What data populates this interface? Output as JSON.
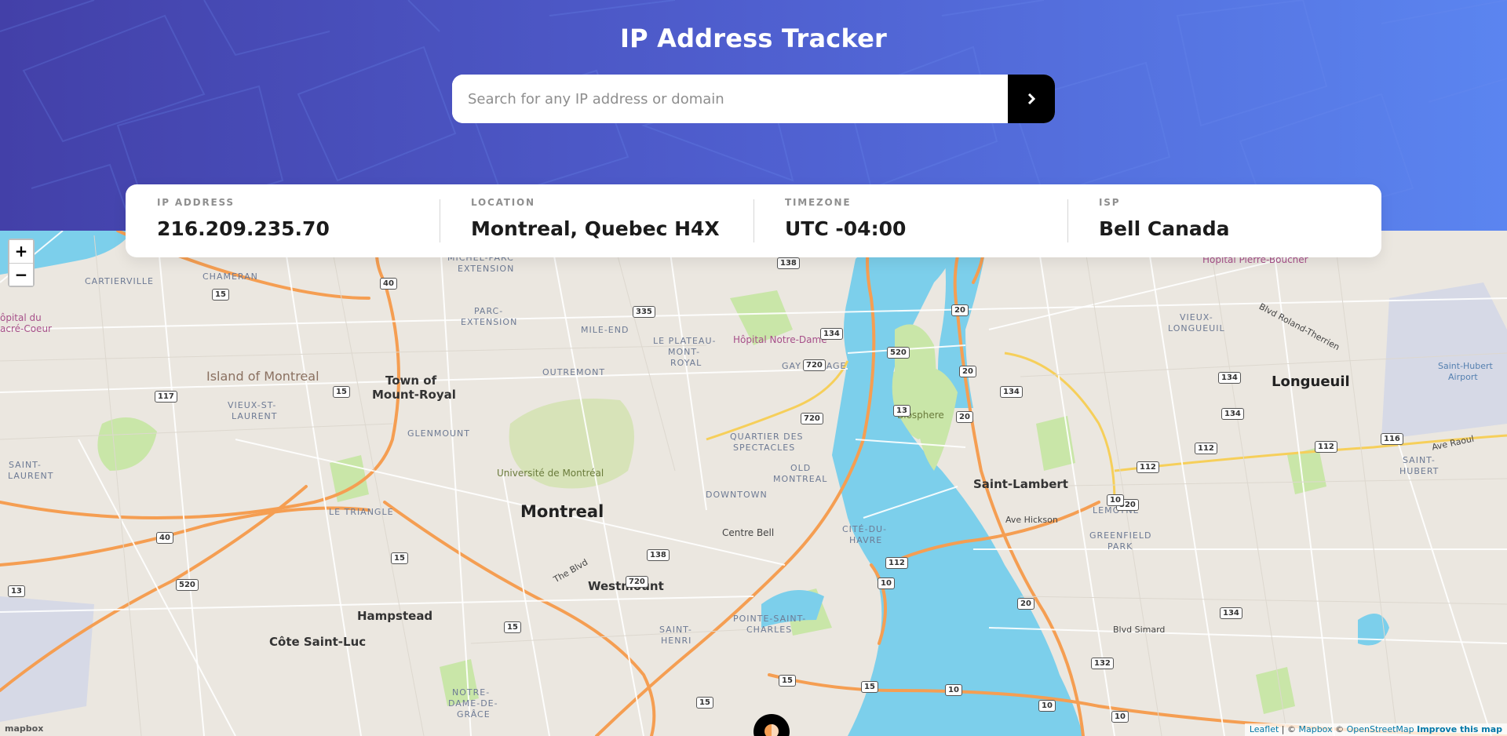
{
  "header": {
    "title": "IP Address Tracker",
    "search_placeholder": "Search for any IP address or domain",
    "search_value": "",
    "submit_icon": "chevron-right-icon",
    "gradient_colors": [
      "#4340a8",
      "#5b85f0"
    ]
  },
  "info": {
    "ip": {
      "label": "IP ADDRESS",
      "value": "216.209.235.70"
    },
    "location": {
      "label": "LOCATION",
      "value": "Montreal, Quebec H4X"
    },
    "timezone": {
      "label": "TIMEZONE",
      "value": "UTC -04:00"
    },
    "isp": {
      "label": "ISP",
      "value": "Bell Canada"
    }
  },
  "map": {
    "zoom_in": "+",
    "zoom_out": "−",
    "marker_icon": "location-pin-icon",
    "labels": {
      "montreal": "Montreal",
      "longueuil": "Longueuil",
      "saint_lambert": "Saint-Lambert",
      "westmount": "Westmount",
      "hampstead": "Hampstead",
      "cote_saint_luc": "Côte Saint-Luc",
      "town_of_mount_royal_1": "Town of",
      "town_of_mount_royal_2": "Mount-Royal",
      "island_of_montreal": "Island of Montreal",
      "cartierville": "CARTIERVILLE",
      "chameran": "CHAMERAN",
      "michel_parc": "MICHEL-PARC",
      "extension": "EXTENSION",
      "parc_extension_1": "PARC-",
      "parc_extension_2": "EXTENSION",
      "mile_end": "MILE-END",
      "plateau_1": "LE PLATEAU-",
      "plateau_2": "MONT-",
      "plateau_3": "ROYAL",
      "outremont": "OUTREMONT",
      "gay_village": "GAY VILLAGE",
      "vieux_st_laurent_1": "VIEUX-ST-",
      "vieux_st_laurent_2": "LAURENT",
      "glenmount": "GLENMOUNT",
      "quartier_1": "QUARTIER DES",
      "quartier_2": "SPECTACLES",
      "old_montreal_1": "OLD",
      "old_montreal_2": "MONTREAL",
      "downtown": "DOWNTOWN",
      "le_triangle": "LE TRIANGLE",
      "saint_laurent_1": "SAINT-",
      "saint_laurent_2": "LAURENT",
      "cite_du_havre_1": "CITÉ-DU-",
      "cite_du_havre_2": "HAVRE",
      "saint_henri_1": "SAINT-",
      "saint_henri_2": "HENRI",
      "pointe_1": "POINTE-SAINT-",
      "pointe_2": "CHARLES",
      "notre_dame_1": "NOTRE-",
      "notre_dame_2": "DAME-DE-",
      "notre_dame_3": "GRÂCE",
      "vieux_longueuil_1": "VIEUX-",
      "vieux_longueuil_2": "LONGUEUIL",
      "lemoyne": "LEMOYNE",
      "greenfield_1": "GREENFIELD",
      "greenfield_2": "PARK",
      "saint_hubert_1": "SAINT-",
      "saint_hubert_2": "HUBERT",
      "hopital_notre_dame": "Hôpital Notre-Dame",
      "hopital_pierre_boucher": "Hôpital Pierre-Boucher",
      "hopital_coeur_1": "ôpital du",
      "hopital_coeur_2": "acré-Coeur",
      "universite": "Université de Montréal",
      "centre_bell": "Centre Bell",
      "biosphere": "Biosphere",
      "airport_1": "Saint-Hubert",
      "airport_2": "Airport",
      "ave_hickson": "Ave Hickson",
      "boul_simard": "Blvd Simard",
      "the_blvd": "The Blvd",
      "blvd_roland_therrien": "Blvd Roland-Therrien",
      "ave_raoul": "Ave Raoul"
    },
    "highway_shields": [
      "15",
      "40",
      "117",
      "15",
      "13",
      "520",
      "40",
      "15",
      "720",
      "335",
      "134",
      "720",
      "20",
      "20",
      "134",
      "112",
      "112",
      "138",
      "112",
      "10",
      "20",
      "134",
      "132",
      "15",
      "720",
      "15",
      "15",
      "10",
      "10",
      "10",
      "116",
      "112",
      "138",
      "520",
      "13",
      "520",
      "20",
      "15",
      "134",
      "134",
      "10"
    ],
    "attribution": {
      "leaflet": "Leaflet",
      "sep1": " | © ",
      "mapbox": "Mapbox",
      "sep2": " © ",
      "osm": "OpenStreetMap",
      "improve": "Improve this map"
    },
    "mapbox_logo": "mapbox"
  }
}
